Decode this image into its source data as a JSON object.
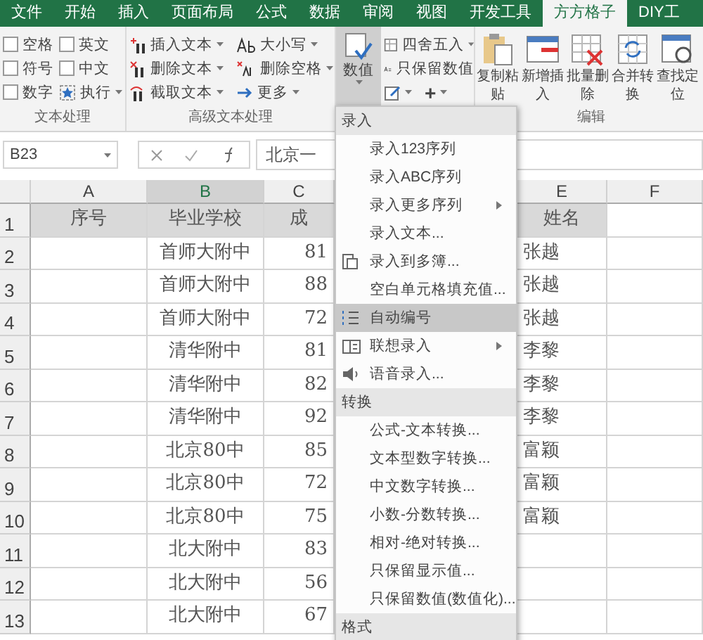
{
  "tabs": [
    {
      "label": "文件",
      "selected": false
    },
    {
      "label": "开始",
      "selected": false
    },
    {
      "label": "插入",
      "selected": false
    },
    {
      "label": "页面布局",
      "selected": false
    },
    {
      "label": "公式",
      "selected": false
    },
    {
      "label": "数据",
      "selected": false
    },
    {
      "label": "审阅",
      "selected": false
    },
    {
      "label": "视图",
      "selected": false
    },
    {
      "label": "开发工具",
      "selected": false
    },
    {
      "label": "方方格子",
      "selected": true
    },
    {
      "label": "DIY工",
      "selected": false
    }
  ],
  "ribbon": {
    "text_group": {
      "label": "文本处理",
      "checkboxes": [
        {
          "label": "空格",
          "checked": false
        },
        {
          "label": "英文",
          "checked": false
        },
        {
          "label": "符号",
          "checked": false
        },
        {
          "label": "中文",
          "checked": false
        },
        {
          "label": "数字",
          "checked": false
        }
      ],
      "run_button": "执行"
    },
    "advanced_group": {
      "label": "高级文本处理",
      "buttons": [
        "插入文本",
        "删除文本",
        "截取文本",
        "大小写",
        "删除空格",
        "更多"
      ]
    },
    "number_group": {
      "value_button": {
        "label": "数值",
        "pressed": true
      },
      "round_button": "四舍五入",
      "keep_value_button": "只保留数值",
      "plus_button": "+"
    },
    "edit_group": {
      "label": "编辑",
      "buttons": [
        "复制粘贴",
        "新增插入",
        "批量删除",
        "合并转换",
        "查找定位"
      ]
    }
  },
  "formula_bar": {
    "name_box": "B23",
    "content": "北京一"
  },
  "sheet": {
    "columns": [
      {
        "label": "A",
        "selected": false
      },
      {
        "label": "B",
        "selected": true
      },
      {
        "label": "C",
        "selected": false
      },
      {
        "label": "E",
        "selected": false
      },
      {
        "label": "F",
        "selected": false
      }
    ],
    "rows": [
      {
        "number": "1",
        "kind": "header",
        "seq": "序号",
        "school": "毕业学校",
        "score": "成",
        "name": "姓名"
      },
      {
        "number": "2",
        "kind": "data",
        "school": "首师大附中",
        "score": "81",
        "name": "张越"
      },
      {
        "number": "3",
        "kind": "data",
        "school": "首师大附中",
        "score": "88",
        "name": "张越"
      },
      {
        "number": "4",
        "kind": "data",
        "school": "首师大附中",
        "score": "72",
        "name": "张越"
      },
      {
        "number": "5",
        "kind": "data",
        "school": "清华附中",
        "score": "81",
        "name": "李黎"
      },
      {
        "number": "6",
        "kind": "data",
        "school": "清华附中",
        "score": "82",
        "name": "李黎"
      },
      {
        "number": "7",
        "kind": "data",
        "school": "清华附中",
        "score": "92",
        "name": "李黎"
      },
      {
        "number": "8",
        "kind": "data",
        "school": "北京80中",
        "score": "85",
        "name": "富颖"
      },
      {
        "number": "9",
        "kind": "data",
        "school": "北京80中",
        "score": "72",
        "name": "富颖"
      },
      {
        "number": "10",
        "kind": "data",
        "school": "北京80中",
        "score": "75",
        "name": "富颖"
      },
      {
        "number": "11",
        "kind": "data",
        "school": "北大附中",
        "score": "83"
      },
      {
        "number": "12",
        "kind": "data",
        "school": "北大附中",
        "score": "56"
      },
      {
        "number": "13",
        "kind": "data",
        "school": "北大附中",
        "score": "67"
      }
    ]
  },
  "menu": {
    "sections": [
      {
        "title": "录入",
        "items": [
          {
            "label": "录入123序列",
            "kind": "item",
            "selected": false
          },
          {
            "label": "录入ABC序列",
            "kind": "item",
            "selected": false
          },
          {
            "label": "录入更多序列",
            "kind": "submenu",
            "selected": false
          },
          {
            "label": "录入文本...",
            "kind": "item",
            "selected": false
          },
          {
            "label": "录入到多簿...",
            "kind": "item",
            "selected": false
          },
          {
            "label": "空白单元格填充值...",
            "kind": "item",
            "selected": false
          },
          {
            "label": "自动编号",
            "kind": "item",
            "selected": true
          },
          {
            "label": "联想录入",
            "kind": "submenu",
            "selected": false
          },
          {
            "label": "语音录入...",
            "kind": "item",
            "selected": false
          }
        ]
      },
      {
        "title": "转换",
        "items": [
          {
            "label": "公式-文本转换...",
            "kind": "item",
            "selected": false
          },
          {
            "label": "文本型数字转换...",
            "kind": "item",
            "selected": false
          },
          {
            "label": "中文数字转换...",
            "kind": "item",
            "selected": false
          },
          {
            "label": "小数-分数转换...",
            "kind": "item",
            "selected": false
          },
          {
            "label": "相对-绝对转换...",
            "kind": "item",
            "selected": false
          },
          {
            "label": "只保留显示值...",
            "kind": "item",
            "selected": false
          },
          {
            "label": "只保留数值(数值化)...",
            "kind": "item",
            "selected": false
          }
        ]
      },
      {
        "title": "格式"
      }
    ]
  }
}
